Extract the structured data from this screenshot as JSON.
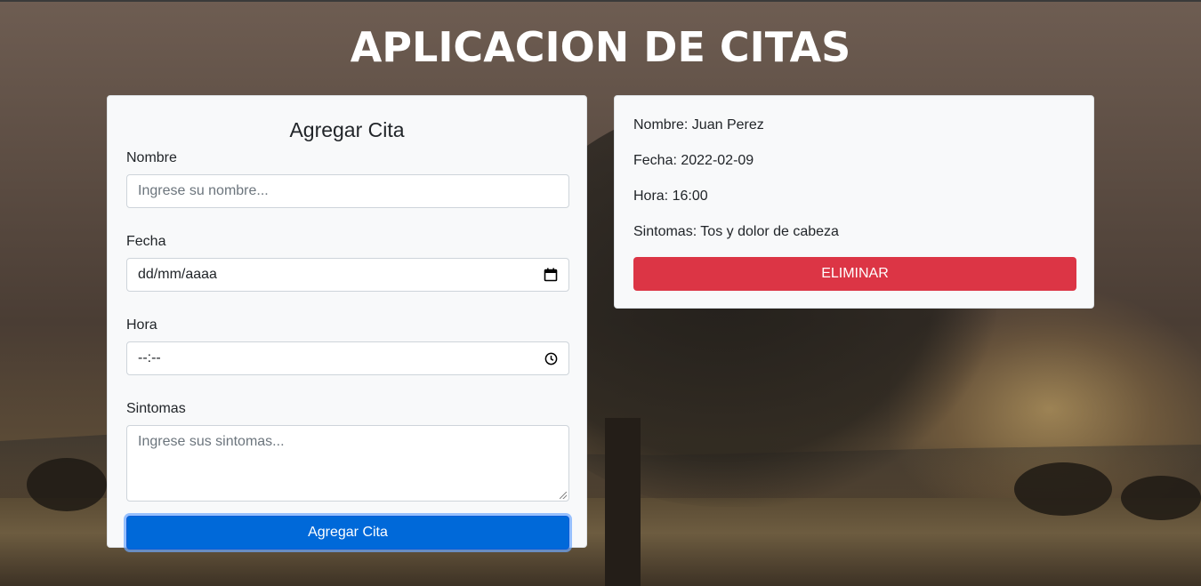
{
  "header": {
    "title": "APLICACION DE CITAS"
  },
  "form": {
    "title": "Agregar Cita",
    "nombre_label": "Nombre",
    "nombre_placeholder": "Ingrese su nombre...",
    "fecha_label": "Fecha",
    "fecha_value": "dd/mm/aaaa",
    "hora_label": "Hora",
    "hora_value": "--:--",
    "sintomas_label": "Sintomas",
    "sintomas_placeholder": "Ingrese sus sintomas...",
    "submit_label": "Agregar Cita"
  },
  "citas": [
    {
      "nombre": "Nombre: Juan Perez",
      "fecha": "Fecha: 2022-02-09",
      "hora": "Hora: 16:00",
      "sintomas": "Sintomas: Tos y dolor de cabeza",
      "delete_label": "ELIMINAR"
    }
  ],
  "icons": {
    "date": "calendar-icon",
    "time": "clock-icon"
  },
  "colors": {
    "primary": "#0069d9",
    "danger": "#dc3545",
    "card_bg": "#f8f9fa"
  }
}
